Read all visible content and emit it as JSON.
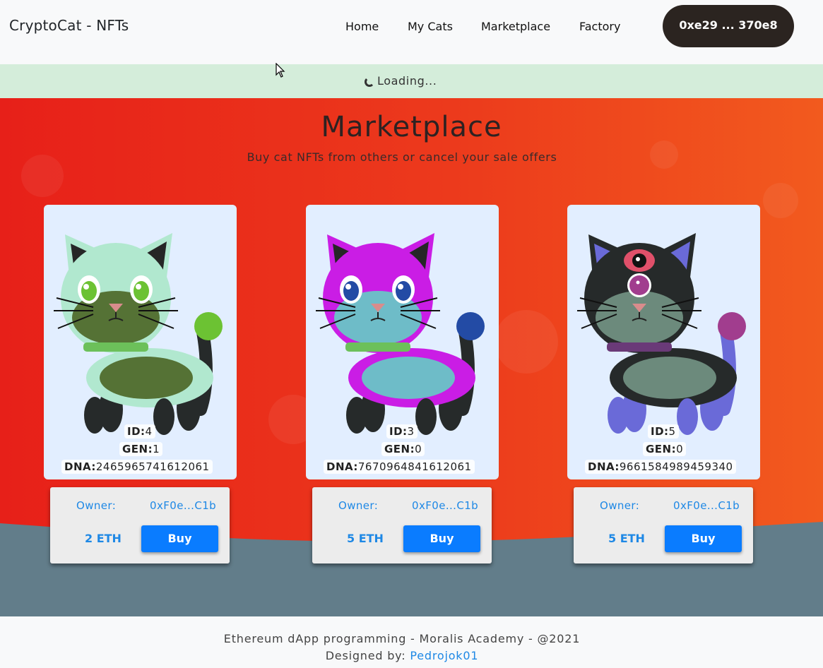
{
  "navbar": {
    "brand": "CryptoCat - NFTs",
    "links": [
      "Home",
      "My Cats",
      "Marketplace",
      "Factory"
    ],
    "wallet": "0xe29 ... 370e8"
  },
  "alert": {
    "text": "Loading..."
  },
  "page": {
    "title": "Marketplace",
    "subtitle": "Buy cat NFTs from others or cancel your sale offers"
  },
  "labels": {
    "id": "ID:",
    "gen": "GEN:",
    "dna": "DNA:",
    "owner": "Owner:",
    "buy": "Buy"
  },
  "cats": [
    {
      "id": "4",
      "gen": "1",
      "dna": "2465965741612061",
      "owner": "0xF0e...C1b",
      "price": "2 ETH",
      "colors": {
        "body": "#b1e8cf",
        "ears_inner": "#262626",
        "belly": "#557235",
        "eyes": "#6cc233",
        "collar": "#6cc05a",
        "tail_ball": "#6cc233",
        "legs": "#262a2a",
        "tail": "#262a2a"
      }
    },
    {
      "id": "3",
      "gen": "0",
      "dna": "7670964841612061",
      "owner": "0xF0e...C1b",
      "price": "5 ETH",
      "colors": {
        "body": "#ca1de5",
        "ears_inner": "#262626",
        "belly": "#6ebcc8",
        "eyes": "#234ba5",
        "collar": "#6cc05a",
        "tail_ball": "#234ba5",
        "legs": "#262a2a",
        "tail": "#262a2a"
      }
    },
    {
      "id": "5",
      "gen": "0",
      "dna": "9661584989459340",
      "owner": "0xF0e...C1b",
      "price": "5 ETH",
      "colors": {
        "body": "#262a2a",
        "ears_inner": "#6a6ad8",
        "belly": "#6c8a7c",
        "eyes": "#a13d8e",
        "collar": "#6a3a78",
        "tail_ball": "#a13d8e",
        "legs": "#6a6ad8",
        "tail": "#6a6ad8",
        "third_eye": "#e0506a"
      }
    }
  ],
  "footer": {
    "line1": "Ethereum dApp programming - Moralis Academy - @2021",
    "designed_by": "Designed by:",
    "author": "Pedrojok01"
  }
}
